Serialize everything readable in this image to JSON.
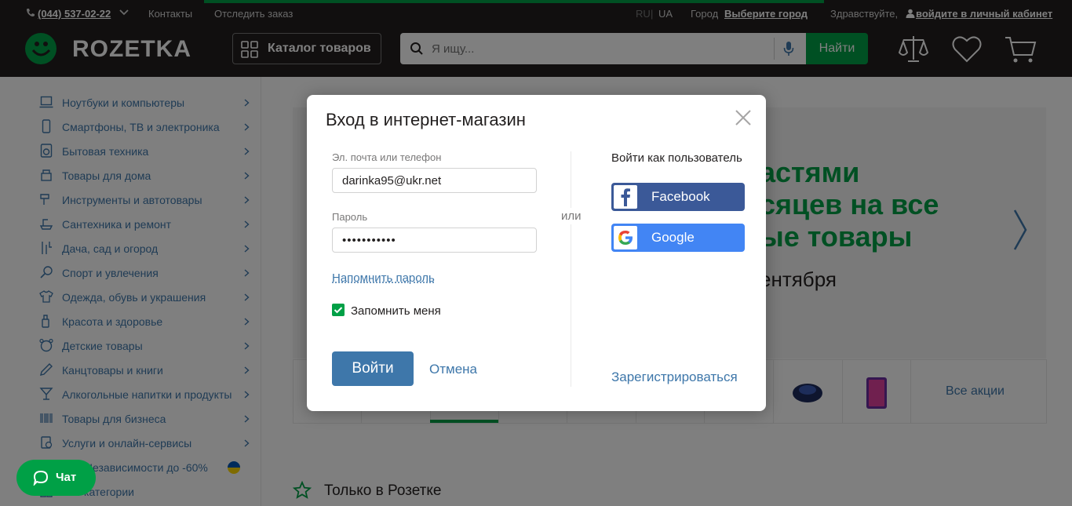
{
  "header": {
    "phone": "(044) 537-02-22",
    "contacts": "Контакты",
    "track_order": "Отследить заказ",
    "lang_ru": "RU",
    "lang_ua": "UA",
    "city_label": "Город",
    "city_value": "Выберите город",
    "greeting": "Здравствуйте,",
    "login_link": "войдите в личный кабинет",
    "logo": "ROZETKA",
    "catalog_button": "Каталог товаров",
    "search_placeholder": "Я ищу...",
    "find_button": "Найти"
  },
  "sidebar": {
    "categories": [
      {
        "label": "Ноутбуки и компьютеры",
        "icon": "laptop-icon"
      },
      {
        "label": "Смартфоны, ТВ и электроника",
        "icon": "smartphone-icon"
      },
      {
        "label": "Бытовая техника",
        "icon": "washing-machine-icon"
      },
      {
        "label": "Товары для дома",
        "icon": "home-goods-icon"
      },
      {
        "label": "Инструменты и автотовары",
        "icon": "tools-icon"
      },
      {
        "label": "Сантехника и ремонт",
        "icon": "plumbing-icon"
      },
      {
        "label": "Дача, сад и огород",
        "icon": "garden-icon"
      },
      {
        "label": "Спорт и увлечения",
        "icon": "sport-icon"
      },
      {
        "label": "Одежда, обувь и украшения",
        "icon": "clothes-icon"
      },
      {
        "label": "Красота и здоровье",
        "icon": "beauty-icon"
      },
      {
        "label": "Детские товары",
        "icon": "kids-icon"
      },
      {
        "label": "Канцтовары и книги",
        "icon": "stationery-icon"
      },
      {
        "label": "Алкогольные напитки и продукты",
        "icon": "drinks-icon"
      },
      {
        "label": "Товары для бизнеса",
        "icon": "barcode-icon"
      },
      {
        "label": "Услуги и онлайн-сервисы",
        "icon": "services-icon"
      },
      {
        "label": "Дни Независимости до -60%",
        "icon": "ukraine-flag-icon"
      },
      {
        "label": "Все категории",
        "icon": "grid-icon"
      }
    ]
  },
  "banner": {
    "line1": "астями",
    "line2": "сяцев на все",
    "line3": "ые товары",
    "subline": "ентября"
  },
  "promos": {
    "all": "Все акции"
  },
  "section": {
    "only_rozetka": "Только в Розетке"
  },
  "chat": {
    "label": "Чат"
  },
  "modal": {
    "title": "Вход в интернет-магазин",
    "email_label": "Эл. почта или телефон",
    "email_value": "darinka95@ukr.net",
    "password_label": "Пароль",
    "password_value": "•••••••••••",
    "remind_password": "Напомнить пароль",
    "remember_me": "Запомнить меня",
    "login_button": "Войти",
    "cancel": "Отмена",
    "or": "или",
    "social_title": "Войти как пользователь",
    "facebook": "Facebook",
    "google": "Google",
    "register": "Зарегистрироваться"
  },
  "colors": {
    "brand_green": "#00a046",
    "header_dark": "#221f1f",
    "link_blue": "#3e77aa",
    "facebook": "#3b5998",
    "google": "#4285f4"
  }
}
